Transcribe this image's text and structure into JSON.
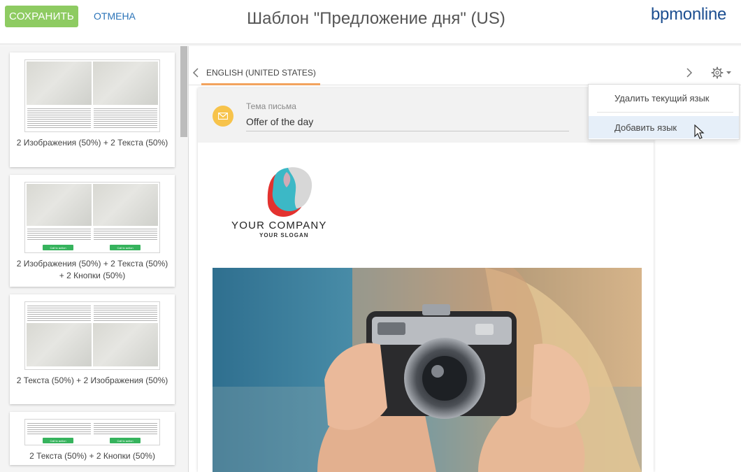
{
  "header": {
    "save_label": "СОХРАНИТЬ",
    "cancel_label": "ОТМЕНА",
    "title": "Шаблон \"Предложение дня\" (US)",
    "brand": "bpmonline"
  },
  "colors": {
    "save_button": "#8ecb62",
    "link": "#2a73b8",
    "brand": "#1d4f91",
    "tab_underline": "#f2a35e",
    "cta_button": "#36b35d",
    "subject_icon": "#f7c34b"
  },
  "templates": [
    {
      "label": "2 Изображения (50%) + 2 Текста (50%)"
    },
    {
      "label": "2 Изображения (50%) + 2 Текста (50%) + 2 Кнопки (50%)",
      "cta": "Call to action"
    },
    {
      "label": "2 Текста (50%) + 2 Изображения (50%)"
    },
    {
      "label": "2 Текста (50%) + 2 Кнопки (50%)",
      "cta": "Call to action"
    }
  ],
  "language_tabs": {
    "active": "ENGLISH (UNITED STATES)",
    "prev_icon": "chevron-left-icon",
    "next_icon": "chevron-right-icon",
    "settings_icon": "gear-icon"
  },
  "email": {
    "subject_caption": "Тема письма",
    "subject_value": "Offer of the day",
    "company_name": "YOUR COMPANY",
    "company_slogan": "YOUR SLOGAN"
  },
  "settings_menu": {
    "items": [
      {
        "label": "Удалить текущий язык"
      },
      {
        "label": "Добавить язык"
      }
    ]
  }
}
